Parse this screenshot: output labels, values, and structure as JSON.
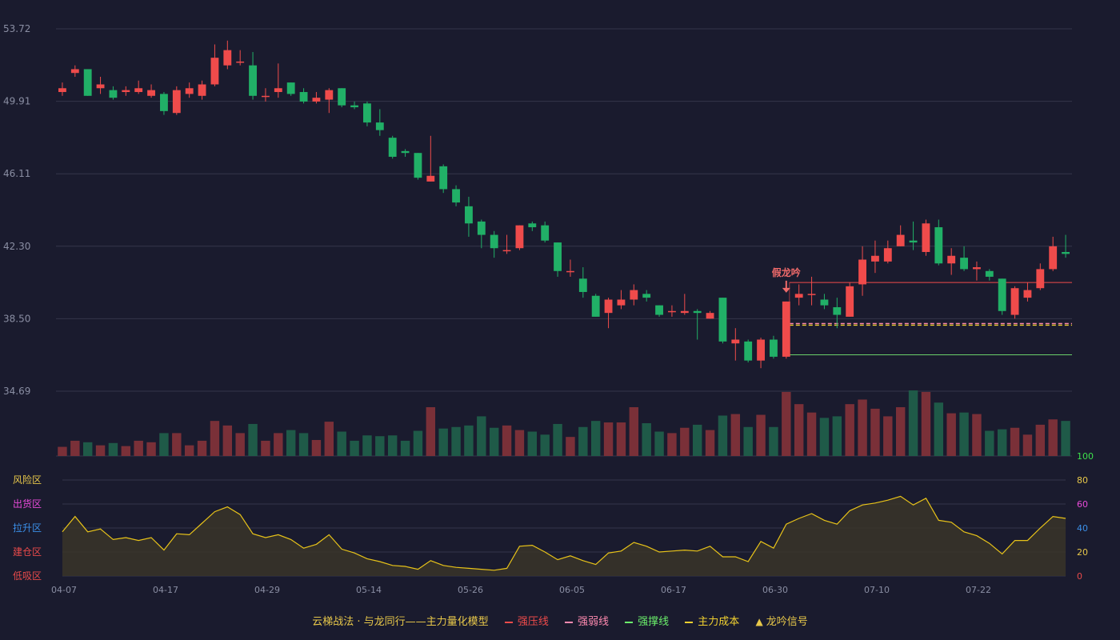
{
  "chart_data": {
    "type": "candlestick",
    "price_ticks": [
      "53.72",
      "49.91",
      "46.11",
      "42.30",
      "38.50",
      "34.69"
    ],
    "date_labels": [
      "04-07",
      "04-17",
      "04-29",
      "05-14",
      "05-26",
      "06-05",
      "06-17",
      "06-30",
      "07-10",
      "07-22"
    ],
    "ylim": [
      34.69,
      53.72
    ],
    "colors": {
      "up": "#ef4b4b",
      "down": "#21b067",
      "up_vol": "#7a3038",
      "down_vol": "#1f5a48",
      "osc": "#e8c319"
    },
    "candles": [
      [
        50.4,
        50.6,
        50.9,
        50.2
      ],
      [
        51.4,
        51.6,
        51.8,
        51.2
      ],
      [
        51.6,
        50.2,
        51.6,
        50.2
      ],
      [
        50.6,
        50.8,
        51.2,
        50.3
      ],
      [
        50.5,
        50.1,
        50.7,
        50.0
      ],
      [
        50.4,
        50.5,
        50.7,
        50.2
      ],
      [
        50.4,
        50.6,
        51.0,
        50.3
      ],
      [
        50.2,
        50.5,
        50.8,
        50.1
      ],
      [
        50.3,
        49.4,
        50.4,
        49.2
      ],
      [
        49.3,
        50.5,
        50.7,
        49.2
      ],
      [
        50.3,
        50.6,
        50.9,
        50.1
      ],
      [
        50.2,
        50.8,
        51.0,
        50.0
      ],
      [
        50.8,
        52.2,
        52.9,
        50.7
      ],
      [
        51.8,
        52.6,
        53.1,
        51.6
      ],
      [
        52.0,
        52.0,
        52.6,
        51.8
      ],
      [
        51.8,
        50.2,
        52.5,
        50.0
      ],
      [
        50.2,
        50.2,
        50.6,
        49.9
      ],
      [
        50.4,
        50.6,
        51.9,
        50.1
      ],
      [
        50.9,
        50.3,
        50.9,
        50.2
      ],
      [
        50.4,
        49.9,
        50.6,
        49.8
      ],
      [
        49.9,
        50.1,
        50.4,
        49.8
      ],
      [
        50.0,
        50.5,
        50.6,
        49.3
      ],
      [
        50.6,
        49.7,
        50.6,
        49.6
      ],
      [
        49.7,
        49.6,
        49.9,
        49.5
      ],
      [
        49.8,
        48.8,
        49.9,
        48.6
      ],
      [
        48.8,
        48.4,
        49.5,
        48.1
      ],
      [
        48.0,
        47.0,
        48.1,
        46.9
      ],
      [
        47.3,
        47.2,
        47.4,
        47.0
      ],
      [
        47.2,
        45.9,
        47.2,
        45.8
      ],
      [
        45.7,
        46.0,
        48.1,
        45.7
      ],
      [
        46.5,
        45.3,
        46.6,
        45.1
      ],
      [
        45.3,
        44.6,
        45.5,
        44.4
      ],
      [
        44.4,
        43.5,
        44.9,
        42.8
      ],
      [
        43.6,
        42.9,
        43.7,
        42.2
      ],
      [
        42.9,
        42.2,
        43.1,
        41.7
      ],
      [
        42.1,
        42.1,
        42.9,
        41.9
      ],
      [
        42.2,
        43.4,
        43.4,
        42.1
      ],
      [
        43.5,
        43.3,
        43.6,
        43.1
      ],
      [
        43.4,
        42.6,
        43.6,
        42.5
      ],
      [
        42.5,
        41.0,
        42.5,
        40.7
      ],
      [
        41.0,
        41.0,
        41.6,
        40.7
      ],
      [
        40.6,
        39.9,
        41.2,
        39.6
      ],
      [
        39.7,
        38.6,
        39.8,
        38.6
      ],
      [
        38.8,
        39.5,
        39.6,
        38.0
      ],
      [
        39.2,
        39.5,
        40.0,
        39.0
      ],
      [
        39.5,
        40.0,
        40.3,
        39.2
      ],
      [
        39.8,
        39.6,
        40.0,
        39.4
      ],
      [
        39.2,
        38.7,
        39.2,
        38.6
      ],
      [
        38.9,
        38.9,
        39.2,
        38.6
      ],
      [
        38.8,
        38.9,
        39.8,
        38.7
      ],
      [
        38.9,
        38.8,
        39.0,
        37.4
      ],
      [
        38.5,
        38.8,
        38.9,
        38.5
      ],
      [
        39.6,
        37.3,
        39.6,
        37.2
      ],
      [
        37.2,
        37.4,
        38.0,
        36.3
      ],
      [
        37.3,
        36.3,
        37.4,
        36.2
      ],
      [
        36.3,
        37.4,
        37.5,
        35.9
      ],
      [
        37.4,
        36.5,
        37.6,
        36.4
      ],
      [
        36.5,
        39.4,
        39.4,
        36.4
      ],
      [
        39.6,
        39.8,
        40.3,
        39.2
      ],
      [
        39.8,
        39.8,
        40.7,
        39.2
      ],
      [
        39.5,
        39.2,
        39.8,
        39.0
      ],
      [
        39.1,
        38.7,
        39.6,
        38.0
      ],
      [
        38.6,
        40.2,
        40.4,
        38.6
      ],
      [
        40.3,
        41.6,
        42.3,
        39.7
      ],
      [
        41.5,
        41.8,
        42.6,
        40.9
      ],
      [
        41.5,
        42.2,
        42.6,
        41.4
      ],
      [
        42.3,
        42.9,
        43.4,
        42.3
      ],
      [
        42.6,
        42.5,
        43.6,
        42.1
      ],
      [
        42.0,
        43.5,
        43.7,
        41.8
      ],
      [
        43.3,
        41.4,
        43.7,
        41.3
      ],
      [
        41.4,
        41.8,
        42.2,
        40.8
      ],
      [
        41.7,
        41.1,
        42.3,
        41.0
      ],
      [
        41.1,
        41.2,
        41.5,
        40.5
      ],
      [
        41.0,
        40.7,
        41.1,
        40.5
      ],
      [
        40.6,
        38.9,
        40.6,
        38.7
      ],
      [
        38.7,
        40.1,
        40.2,
        38.5
      ],
      [
        39.6,
        40.0,
        40.4,
        39.4
      ],
      [
        40.1,
        41.1,
        41.4,
        40.0
      ],
      [
        41.1,
        42.3,
        42.8,
        41.0
      ],
      [
        42.0,
        41.9,
        42.9,
        41.7
      ]
    ],
    "volume": [
      12,
      20,
      18,
      14,
      17,
      13,
      20,
      18,
      30,
      30,
      14,
      20,
      46,
      40,
      30,
      42,
      20,
      30,
      34,
      30,
      21,
      45,
      32,
      20,
      27,
      26,
      27,
      20,
      33,
      64,
      36,
      38,
      40,
      52,
      37,
      40,
      34,
      32,
      28,
      42,
      25,
      38,
      46,
      44,
      44,
      64,
      43,
      32,
      30,
      37,
      41,
      34,
      53,
      55,
      38,
      54,
      38,
      84,
      68,
      57,
      50,
      52,
      68,
      74,
      62,
      52,
      64,
      86,
      84,
      70,
      56,
      57,
      55,
      33,
      35,
      37,
      28,
      41,
      48,
      46
    ],
    "oscillator": [
      46,
      62,
      46,
      49,
      38,
      40,
      37,
      40,
      27,
      44,
      43,
      55,
      67,
      72,
      64,
      44,
      40,
      43,
      38,
      29,
      33,
      43,
      28,
      24,
      18,
      15,
      11,
      10,
      7,
      16,
      11,
      9,
      8,
      7,
      6,
      8,
      31,
      32,
      25,
      17,
      21,
      16,
      12,
      24,
      26,
      35,
      31,
      25,
      26,
      27,
      26,
      31,
      20,
      20,
      15,
      36,
      29,
      54,
      60,
      65,
      58,
      54,
      68,
      74,
      76,
      79,
      83,
      74,
      81,
      58,
      56,
      46,
      42,
      34,
      23,
      37,
      37,
      50,
      62,
      60
    ],
    "osc_ticks": [
      "100",
      "80",
      "60",
      "40",
      "20",
      "0"
    ],
    "osc_tick_colors": [
      "#3de04b",
      "#e8c84a",
      "#e84ad9",
      "#3b8fe8",
      "#e8c84a",
      "#e84a4a"
    ],
    "zones": [
      {
        "label": "风险区",
        "color": "#e8c84a"
      },
      {
        "label": "出货区",
        "color": "#e84ad9"
      },
      {
        "label": "拉升区",
        "color": "#3b8fe8"
      },
      {
        "label": "建仓区",
        "color": "#e84a4a"
      },
      {
        "label": "低吸区",
        "color": "#e84a4a"
      }
    ],
    "levels": {
      "strong_pressure": 40.4,
      "main_cost": 38.2,
      "strong_support": 36.6,
      "start_index": 57
    },
    "signal": {
      "label": "假龙吟",
      "index": 57,
      "color": "#ef6a6a"
    }
  },
  "legend": {
    "title": "云梯战法 · 与龙同行——主力量化模型",
    "items": [
      {
        "label": "强压线",
        "color": "#ef4b4b",
        "style": "solid"
      },
      {
        "label": "强弱线",
        "color": "#ff8ab0",
        "style": "dashed"
      },
      {
        "label": "强撑线",
        "color": "#6bf06b",
        "style": "solid"
      },
      {
        "label": "主力成本",
        "color": "#f0d030",
        "style": "dashed"
      }
    ],
    "signal_label": "龙吟信号",
    "signal_icon": "triangle-up-icon"
  }
}
